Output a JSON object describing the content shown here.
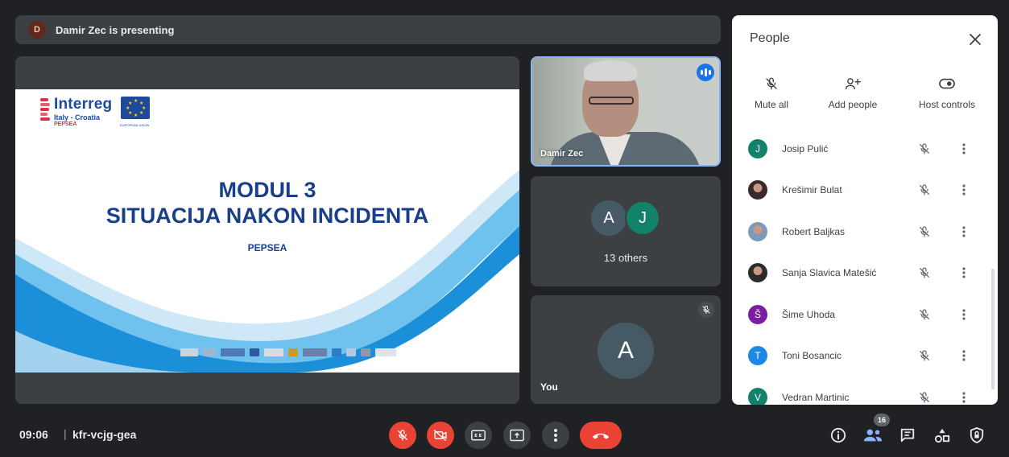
{
  "banner": {
    "avatar_letter": "D",
    "text": "Damir Zec is presenting"
  },
  "slide": {
    "logo_brand": "Interreg",
    "logo_sub": "Italy - Croatia",
    "logo_project": "PEPSEA",
    "logo_eu_caption": "EUROPEAN UNION",
    "title_line1": "MODUL 3",
    "title_line2": "SITUACIJA NAKON INCIDENTA",
    "subtitle": "PEPSEA"
  },
  "tiles": {
    "presenter_name": "Damir Zec",
    "others_avatar_1": "A",
    "others_avatar_2": "J",
    "others_count": "13 others",
    "you_avatar": "A",
    "you_label": "You"
  },
  "people_panel": {
    "title": "People",
    "actions": [
      {
        "label": "Mute all",
        "icon": "mic-off-icon"
      },
      {
        "label": "Add people",
        "icon": "add-person-icon"
      },
      {
        "label": "Host controls",
        "icon": "toggle-icon"
      }
    ],
    "participants": [
      {
        "name": "Josip Pulić",
        "initial": "J",
        "color": "#12826b",
        "photo": false
      },
      {
        "name": "Krešimir Bulat",
        "initial": "",
        "color": "#3a2a2a",
        "photo": true
      },
      {
        "name": "Robert Baljkas",
        "initial": "",
        "color": "#7d9ab8",
        "photo": true
      },
      {
        "name": "Sanja Slavica Matešić",
        "initial": "",
        "color": "#2b2b2b",
        "photo": true
      },
      {
        "name": "Šime Uhoda",
        "initial": "Š",
        "color": "#7b1fa2",
        "photo": false
      },
      {
        "name": "Toni Bosancic",
        "initial": "T",
        "color": "#1e88e5",
        "photo": false
      },
      {
        "name": "Vedran Martinic",
        "initial": "V",
        "color": "#12826b",
        "photo": false
      }
    ]
  },
  "bottom_bar": {
    "time": "09:06",
    "separator": "|",
    "meeting_code": "kfr-vcjg-gea",
    "people_count": "16",
    "colors": {
      "danger": "#ea4335",
      "neutral": "#3c4043",
      "accent": "#8ab4f8"
    }
  }
}
